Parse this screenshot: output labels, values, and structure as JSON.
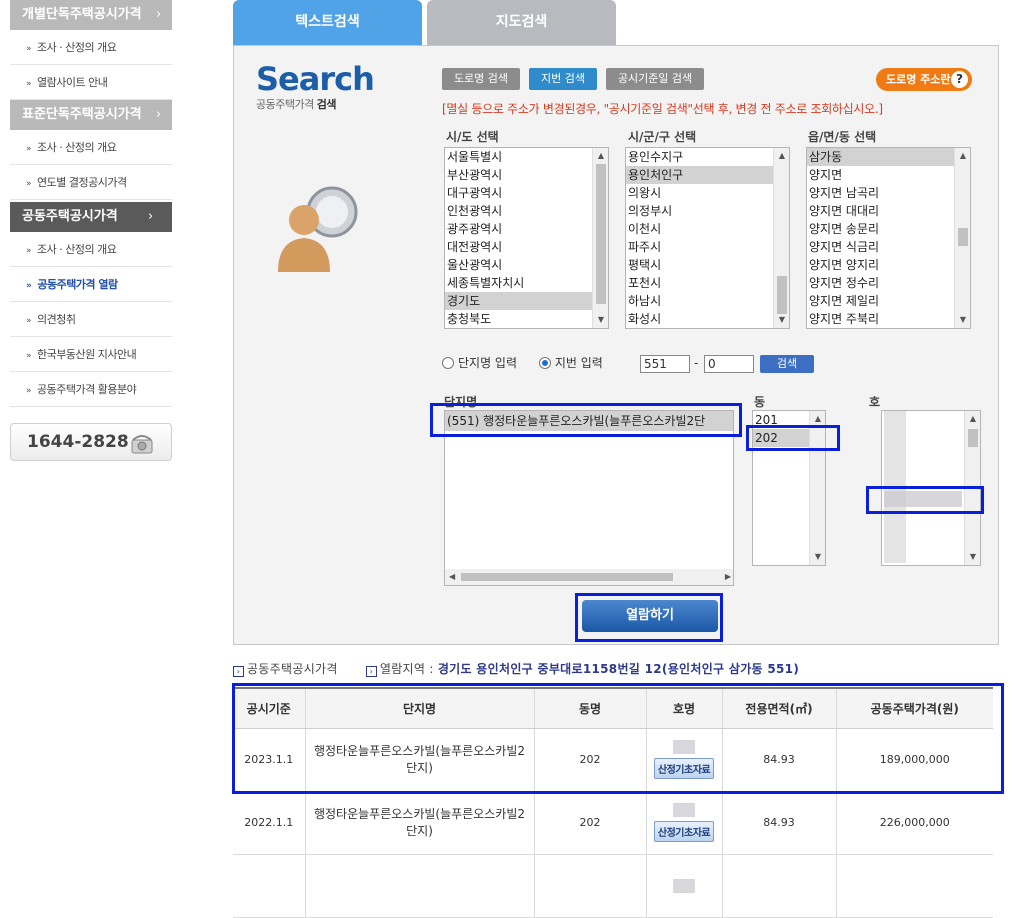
{
  "sidebar": {
    "sections": [
      {
        "title": "개별단독주택공시가격",
        "items": [
          "조사 · 산정의 개요",
          "열람사이트 안내"
        ]
      },
      {
        "title": "표준단독주택공시가격",
        "items": [
          "조사 · 산정의 개요",
          "연도별 결정공시가격"
        ]
      },
      {
        "title": "공동주택공시가격",
        "items": [
          "조사 · 산정의 개요",
          "공동주택가격 열람",
          "의견청취",
          "한국부동산원 지사안내",
          "공동주택가격 활용분야"
        ]
      }
    ],
    "arrow": "›",
    "bullet": "»",
    "phone": "1644-2828"
  },
  "tabs": {
    "text_search": "텍스트검색",
    "map_search": "지도검색"
  },
  "search": {
    "logo": "Search",
    "subtitle_prefix": "공동주택가격 ",
    "subtitle_bold": "검색",
    "btn_road": "도로명 검색",
    "btn_lot": "지번 검색",
    "btn_date": "공시기준일 검색",
    "btn_road_addr": "도로명 주소란",
    "help": "?",
    "notice": "[멸실 등으로 주소가 변경된경우, \"공시기준일 검색\"선택 후, 변경 전 주소로 조회하십시오.]",
    "label_sido": "시/도 선택",
    "label_sigungu": "시/군/구 선택",
    "label_dong": "읍/면/동 선택",
    "sido": [
      "서울특별시",
      "부산광역시",
      "대구광역시",
      "인천광역시",
      "광주광역시",
      "대전광역시",
      "울산광역시",
      "세종특별자치시",
      "경기도",
      "충청북도"
    ],
    "sigungu": [
      "용인수지구",
      "용인처인구",
      "의왕시",
      "의정부시",
      "이천시",
      "파주시",
      "평택시",
      "포천시",
      "하남시",
      "화성시"
    ],
    "emd": [
      "삼가동",
      "양지면",
      "양지면 남곡리",
      "양지면 대대리",
      "양지면 송문리",
      "양지면 식금리",
      "양지면 양지리",
      "양지면 정수리",
      "양지면 제일리",
      "양지면 주북리"
    ],
    "radio_complex": "단지명 입력",
    "radio_lot": "지번 입력",
    "lot_main": "551",
    "dash": "-",
    "lot_sub": "0",
    "btn_search": "검색",
    "label_complex": "단지명",
    "label_building": "동",
    "label_unit": "호",
    "complex_item": "(551) 행정타운늘푸른오스카빌(늘푸른오스카빌2단",
    "buildings": [
      "201",
      "202"
    ],
    "btn_view": "열람하기"
  },
  "info": {
    "box": "›",
    "title": "공동주택공시가격",
    "region_label": "열람지역 :",
    "region": "경기도 용인처인구 중부대로1158번길 12(용인처인구 삼가동 551)"
  },
  "table": {
    "headers": [
      "공시기준",
      "단지명",
      "동명",
      "호명",
      "전용면적(㎡)",
      "공동주택가격(원)"
    ],
    "rows": [
      {
        "date": "2023.1.1",
        "name": "행정타운늘푸른오스카빌(늘푸른오스카빌2단지)",
        "dong": "202",
        "doc": "산정기초자료",
        "area": "84.93",
        "price": "189,000,000"
      },
      {
        "date": "2022.1.1",
        "name": "행정타운늘푸른오스카빌(늘푸른오스카빌2단지)",
        "dong": "202",
        "doc": "산정기초자료",
        "area": "84.93",
        "price": "226,000,000"
      }
    ]
  },
  "colors": {
    "accent": "#4fa3e6",
    "highlight": "#0a1fdc",
    "notice": "#d83a1f",
    "orange": "#f07a14"
  }
}
